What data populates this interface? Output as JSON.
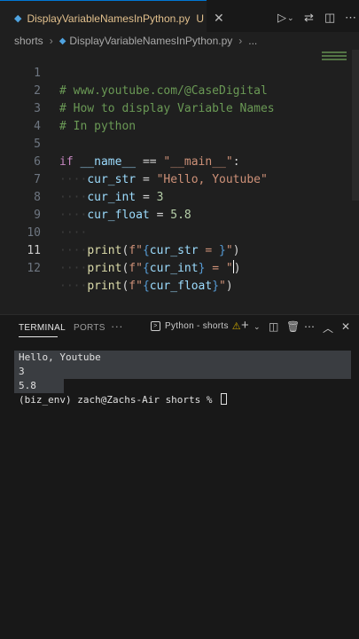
{
  "tab": {
    "filename": "DisplayVariableNamesInPython.py",
    "modified": "U",
    "close": "✕"
  },
  "breadcrumb": {
    "folder": "shorts",
    "file": "DisplayVariableNamesInPython.py",
    "more": "..."
  },
  "editor": {
    "line_numbers": [
      "1",
      "2",
      "3",
      "4",
      "5",
      "6",
      "7",
      "8",
      "9",
      "10",
      "11",
      "12"
    ],
    "comments": [
      "# www.youtube.com/@CaseDigital",
      "# How to display Variable Names",
      "# In python"
    ],
    "kw_if": "if",
    "dunder_name": "__name__",
    "eq": "==",
    "main_str": "\"__main__\"",
    "colon": ":",
    "cur_str": "cur_str",
    "hello_str": "\"Hello, Youtube\"",
    "cur_int": "cur_int",
    "int_val": "3",
    "cur_float": "cur_float",
    "float_val": "5.8",
    "assign": "=",
    "print": "print",
    "f_prefix": "f\"",
    "open_brace": "{",
    "close_brace": "}",
    "equals_space": " = ",
    "close_quote": "\"",
    "paren_open": "(",
    "paren_close": ")",
    "indent_dots": "····"
  },
  "panel": {
    "tabs": [
      "TERMINAL",
      "PORTS",
      "···"
    ],
    "terminal_label": "Python - shorts",
    "icons": [
      "add-icon",
      "split-icon",
      "trash-icon",
      "more-icon",
      "chevron-up-icon",
      "close-icon"
    ]
  },
  "terminal": {
    "output": [
      "Hello, Youtube",
      "3",
      "5.8"
    ],
    "prompt": "(biz_env) zach@Zachs-Air shorts % "
  }
}
